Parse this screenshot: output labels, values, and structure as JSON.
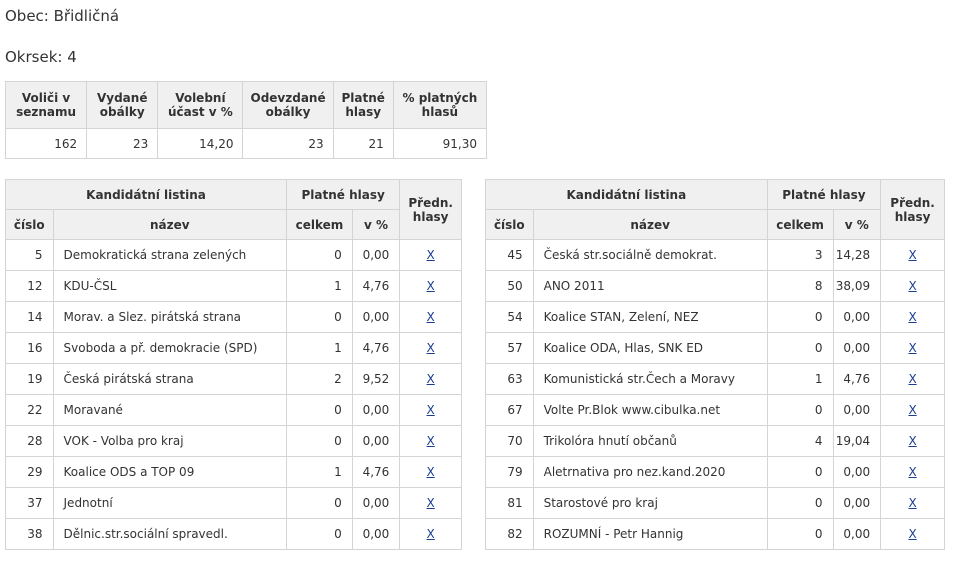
{
  "obec_label": "Obec: Břidličná",
  "okrsek_label": "Okrsek: 4",
  "summary": {
    "headers": [
      "Voliči v seznamu",
      "Vydané obálky",
      "Volební účast v %",
      "Odevzdané obálky",
      "Platné hlasy",
      "% platných hlasů"
    ],
    "values": [
      "162",
      "23",
      "14,20",
      "23",
      "21",
      "91,30"
    ]
  },
  "candidates": {
    "h_listina": "Kandidátní listina",
    "h_platne": "Platné hlasy",
    "h_predn": "Předn. hlasy",
    "h_cislo": "číslo",
    "h_nazev": "název",
    "h_celkem": "celkem",
    "h_pct": "v %",
    "x_label": "X",
    "left": [
      {
        "cislo": "5",
        "nazev": "Demokratická strana zelených",
        "celkem": "0",
        "pct": "0,00"
      },
      {
        "cislo": "12",
        "nazev": "KDU-ČSL",
        "celkem": "1",
        "pct": "4,76"
      },
      {
        "cislo": "14",
        "nazev": "Morav. a Slez. pirátská strana",
        "celkem": "0",
        "pct": "0,00"
      },
      {
        "cislo": "16",
        "nazev": "Svoboda a př. demokracie (SPD)",
        "celkem": "1",
        "pct": "4,76"
      },
      {
        "cislo": "19",
        "nazev": "Česká pirátská strana",
        "celkem": "2",
        "pct": "9,52"
      },
      {
        "cislo": "22",
        "nazev": "Moravané",
        "celkem": "0",
        "pct": "0,00"
      },
      {
        "cislo": "28",
        "nazev": "VOK - Volba pro kraj",
        "celkem": "0",
        "pct": "0,00"
      },
      {
        "cislo": "29",
        "nazev": "Koalice ODS a TOP 09",
        "celkem": "1",
        "pct": "4,76"
      },
      {
        "cislo": "37",
        "nazev": "Jednotní",
        "celkem": "0",
        "pct": "0,00"
      },
      {
        "cislo": "38",
        "nazev": "Dělnic.str.sociální spravedl.",
        "celkem": "0",
        "pct": "0,00"
      }
    ],
    "right": [
      {
        "cislo": "45",
        "nazev": "Česká str.sociálně demokrat.",
        "celkem": "3",
        "pct": "14,28"
      },
      {
        "cislo": "50",
        "nazev": "ANO 2011",
        "celkem": "8",
        "pct": "38,09"
      },
      {
        "cislo": "54",
        "nazev": "Koalice STAN, Zelení, NEZ",
        "celkem": "0",
        "pct": "0,00"
      },
      {
        "cislo": "57",
        "nazev": "Koalice ODA, Hlas, SNK ED",
        "celkem": "0",
        "pct": "0,00"
      },
      {
        "cislo": "63",
        "nazev": "Komunistická str.Čech a Moravy",
        "celkem": "1",
        "pct": "4,76"
      },
      {
        "cislo": "67",
        "nazev": "Volte Pr.Blok www.cibulka.net",
        "celkem": "0",
        "pct": "0,00"
      },
      {
        "cislo": "70",
        "nazev": "Trikolóra hnutí občanů",
        "celkem": "4",
        "pct": "19,04"
      },
      {
        "cislo": "79",
        "nazev": "Aletrnativa pro nez.kand.2020",
        "celkem": "0",
        "pct": "0,00"
      },
      {
        "cislo": "81",
        "nazev": "Starostové pro kraj",
        "celkem": "0",
        "pct": "0,00"
      },
      {
        "cislo": "82",
        "nazev": "ROZUMNÍ - Petr Hannig",
        "celkem": "0",
        "pct": "0,00"
      }
    ]
  }
}
